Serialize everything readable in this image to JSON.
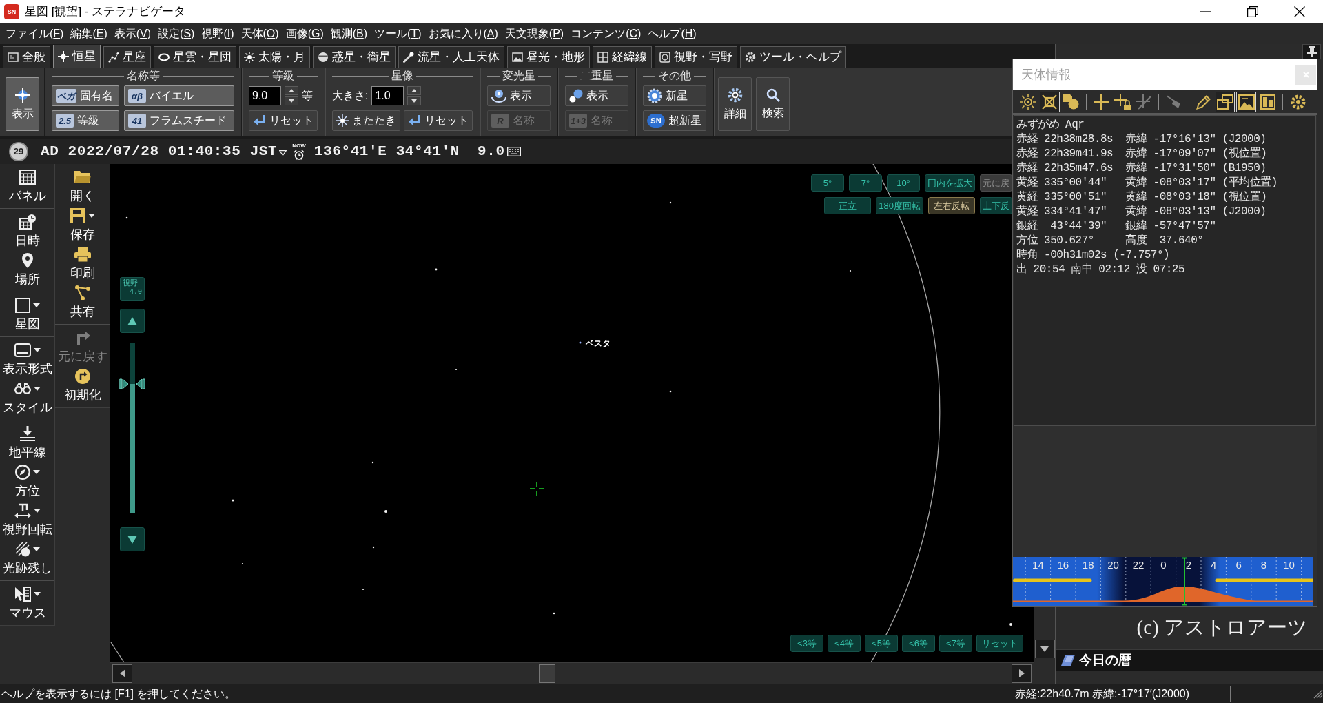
{
  "window": {
    "title": "星図 [観望] - ステラナビゲータ",
    "icon_text": "SN"
  },
  "menu": [
    {
      "label": "ファイル(",
      "key": "F",
      "after": ")"
    },
    {
      "label": "編集(",
      "key": "E",
      "after": ")"
    },
    {
      "label": "表示(",
      "key": "V",
      "after": ")"
    },
    {
      "label": "設定(",
      "key": "S",
      "after": ")"
    },
    {
      "label": "視野(",
      "key": "I",
      "after": ")"
    },
    {
      "label": "天体(",
      "key": "O",
      "after": ")"
    },
    {
      "label": "画像(",
      "key": "G",
      "after": ")"
    },
    {
      "label": "観測(",
      "key": "B",
      "after": ")"
    },
    {
      "label": "ツール(",
      "key": "T",
      "after": ")"
    },
    {
      "label": "お気に入り(",
      "key": "A",
      "after": ")"
    },
    {
      "label": "天文現象(",
      "key": "P",
      "after": ")"
    },
    {
      "label": "コンテンツ(",
      "key": "C",
      "after": ")"
    },
    {
      "label": "ヘルプ(",
      "key": "H",
      "after": ")"
    }
  ],
  "tabs": [
    {
      "label": "全般",
      "selected": false
    },
    {
      "label": "恒星",
      "selected": true
    },
    {
      "label": "星座",
      "selected": false
    },
    {
      "label": "星雲・星団",
      "selected": false
    },
    {
      "label": "太陽・月",
      "selected": false
    },
    {
      "label": "惑星・衛星",
      "selected": false
    },
    {
      "label": "流星・人工天体",
      "selected": false
    },
    {
      "label": "昼光・地形",
      "selected": false
    },
    {
      "label": "経緯線",
      "selected": false
    },
    {
      "label": "視野・写野",
      "selected": false
    },
    {
      "label": "ツール・ヘルプ",
      "selected": false
    }
  ],
  "ribbon": {
    "display": {
      "label": "表示",
      "on": true
    },
    "names": {
      "title": "名称等",
      "buttons": [
        {
          "label": "固有名",
          "tag": "ベガ",
          "on": true
        },
        {
          "label": "バイエル",
          "tag": "αβ",
          "on": true
        },
        {
          "label": "等級",
          "tag": "2.5",
          "on": true
        },
        {
          "label": "フラムスチード",
          "tag": "41",
          "on": true
        }
      ]
    },
    "magnitude": {
      "title": "等級",
      "value": "9.0",
      "unit": "等",
      "reset": "リセット"
    },
    "star_image": {
      "title": "星像",
      "size_label": "大きさ:",
      "value": "1.0",
      "twinkle": {
        "label": "またたき",
        "on": false
      },
      "reset": "リセット"
    },
    "variable_stars": {
      "title": "変光星",
      "show": {
        "label": "表示",
        "on": false
      },
      "names": {
        "label": "名称",
        "tag": "R",
        "disabled": true
      }
    },
    "double_stars": {
      "title": "二重星",
      "show": {
        "label": "表示",
        "on": false
      },
      "names": {
        "label": "名称",
        "tag": "1+3",
        "disabled": true
      }
    },
    "other": {
      "title": "その他",
      "nova": {
        "label": "新星",
        "on": false
      },
      "supernova": {
        "label": "超新星",
        "tag": "SN",
        "on": false
      }
    },
    "details": "詳細",
    "search": "検索"
  },
  "date_bar": {
    "day_badge": "29",
    "datetime": "AD 2022/07/28 01:40:35 JST",
    "now_label": "NOW",
    "location": "136°41'E 34°41'N",
    "limiting_magnitude": "9.0"
  },
  "left_toolbar": [
    {
      "items": [
        {
          "label": "パネル",
          "dropdown": false
        }
      ]
    },
    {
      "items": [
        {
          "label": "日時",
          "dropdown": false
        },
        {
          "label": "場所",
          "dropdown": false
        }
      ]
    },
    {
      "items": [
        {
          "label": "星図",
          "dropdown": true
        }
      ]
    },
    {
      "items": [
        {
          "label": "表示形式",
          "dropdown": true
        },
        {
          "label": "スタイル",
          "dropdown": true
        }
      ]
    },
    {
      "items": [
        {
          "label": "地平線",
          "dropdown": false
        },
        {
          "label": "方位",
          "dropdown": true
        },
        {
          "label": "視野回転",
          "dropdown": true
        },
        {
          "label": "光跡残し",
          "dropdown": true
        }
      ]
    },
    {
      "items": [
        {
          "label": "マウス",
          "dropdown": true
        }
      ]
    }
  ],
  "file_toolbar": [
    {
      "items": [
        {
          "label": "開く",
          "dropdown": false,
          "disabled": false
        },
        {
          "label": "保存",
          "dropdown": true,
          "disabled": false
        },
        {
          "label": "印刷",
          "dropdown": false,
          "disabled": false
        },
        {
          "label": "共有",
          "dropdown": false,
          "disabled": false
        }
      ]
    },
    {
      "items": [
        {
          "label": "元に戻す",
          "dropdown": false,
          "disabled": true
        },
        {
          "label": "初期化",
          "dropdown": false,
          "disabled": false
        }
      ]
    }
  ],
  "sky_map": {
    "fov": {
      "label": "視野",
      "value": "4.0"
    },
    "zoom_slider": {
      "level": 0.76
    },
    "view_buttons": [
      {
        "items": [
          {
            "label": "5°",
            "selected": false,
            "disabled": false
          },
          {
            "label": "7°",
            "selected": false,
            "disabled": false
          },
          {
            "label": "10°",
            "selected": false,
            "disabled": false
          },
          {
            "label": "円内を拡大",
            "selected": false,
            "disabled": false
          },
          {
            "label": "元に戻",
            "selected": false,
            "disabled": true
          }
        ]
      },
      {
        "items": [
          {
            "label": "正立",
            "selected": false,
            "disabled": false
          },
          {
            "label": "180度回転",
            "selected": false,
            "disabled": false
          },
          {
            "label": "左右反転",
            "selected": true,
            "disabled": false
          },
          {
            "label": "上下反",
            "selected": false,
            "disabled": false
          }
        ]
      }
    ],
    "object_label": "ベスタ",
    "magnitude_buttons": [
      "<3等",
      "<4等",
      "<5等",
      "<6等",
      "<7等",
      "リセット"
    ]
  },
  "info_window": {
    "title": "天体情報",
    "tools": [
      {
        "selected": false,
        "disabled": false
      },
      {
        "selected": true,
        "disabled": false
      },
      {
        "selected": false,
        "disabled": false
      },
      {
        "selected": false,
        "disabled": false
      },
      {
        "selected": false,
        "disabled": false
      },
      {
        "selected": false,
        "disabled": true
      },
      {
        "selected": false,
        "disabled": true
      },
      {
        "selected": false,
        "disabled": false
      },
      {
        "selected": true,
        "disabled": false
      },
      {
        "selected": true,
        "disabled": false
      },
      {
        "selected": false,
        "disabled": false
      },
      {
        "selected": false,
        "disabled": false
      }
    ],
    "lines": [
      "みずがめ Aqr",
      "赤経 22h38m28.8s  赤緯 -17°16'13″ (J2000)",
      "赤経 22h39m41.9s  赤緯 -17°09'07″ (視位置)",
      "赤経 22h35m47.6s  赤緯 -17°31'50″ (B1950)",
      "黄経 335°00'44″   黄緯 -08°03'17″ (平均位置)",
      "黄経 335°00'51″   黄緯 -08°03'18″ (視位置)",
      "黄経 334°41'47″   黄緯 -08°03'13″ (J2000)",
      "銀経  43°44'39″   銀緯 -57°47'57″",
      "方位 350.627°     高度  37.640°",
      "時角 -00h31m02s (-7.757°)",
      "出 20:54 南中 02:12 没 07:25"
    ],
    "timeline": {
      "hours": [
        "14",
        "16",
        "18",
        "20",
        "22",
        "0",
        "2",
        "4",
        "6",
        "8",
        "10"
      ]
    }
  },
  "side_panel": {
    "copyright": "(c) アストロアーツ",
    "almanac": "今日の暦"
  },
  "status_bar": {
    "help": "ヘルプを表示するには [F1] を押してください。",
    "cursor_position": "赤経:22h40.7m 赤緯:-17°17′(J2000)"
  }
}
